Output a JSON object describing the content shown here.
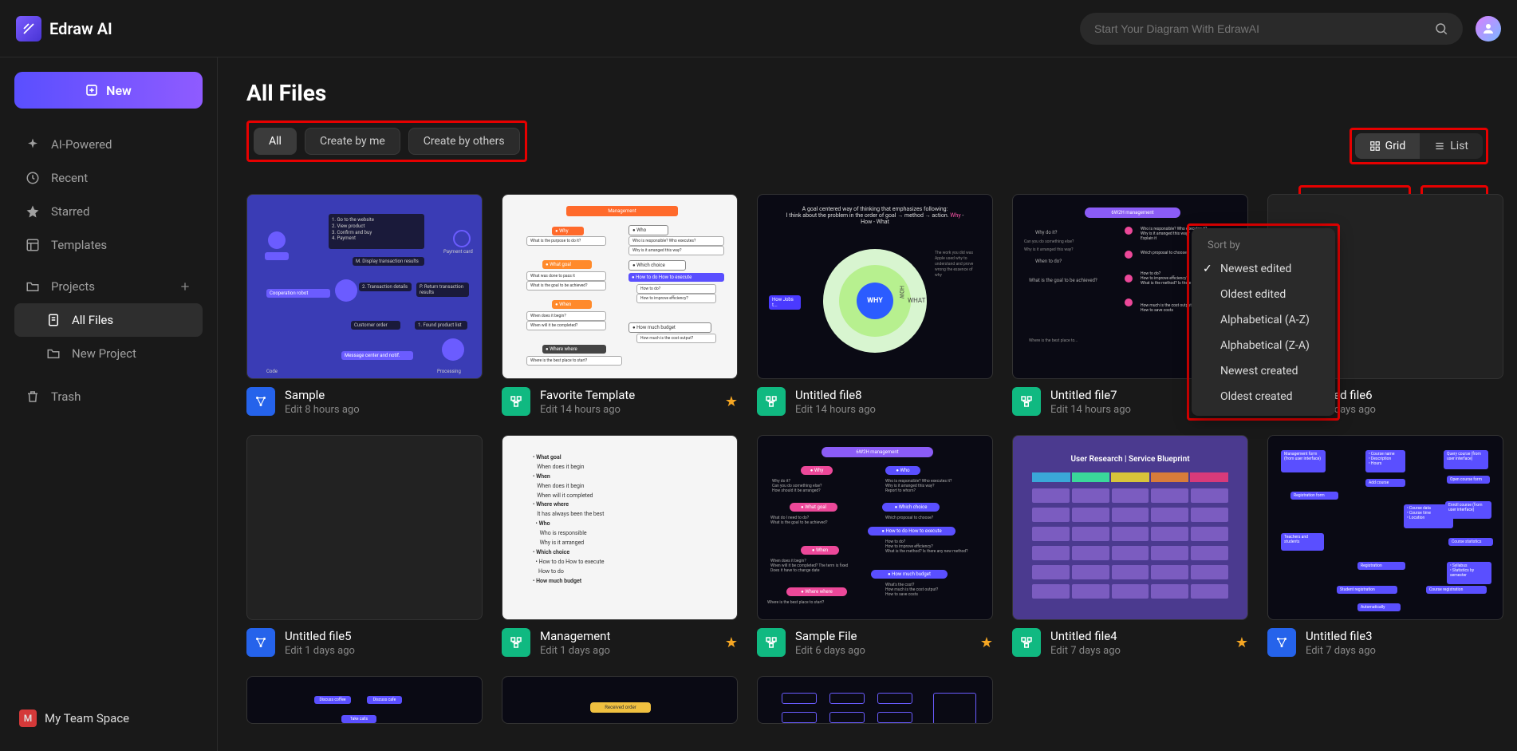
{
  "app_name": "Edraw AI",
  "search_placeholder": "Start Your Diagram With EdrawAI",
  "sidebar": {
    "new_label": "New",
    "items": [
      {
        "label": "AI-Powered",
        "icon": "sparkle-icon"
      },
      {
        "label": "Recent",
        "icon": "clock-icon"
      },
      {
        "label": "Starred",
        "icon": "star-icon"
      },
      {
        "label": "Templates",
        "icon": "template-icon"
      }
    ],
    "projects_label": "Projects",
    "project_children": [
      {
        "label": "All Files",
        "icon": "files-icon",
        "active": true
      },
      {
        "label": "New Project",
        "icon": "folder-icon"
      }
    ],
    "trash_label": "Trash",
    "team_badge": "M",
    "team_label": "My Team Space"
  },
  "page_title": "All Files",
  "tabs": [
    {
      "label": "All",
      "active": true
    },
    {
      "label": "Create by me"
    },
    {
      "label": "Create by others"
    }
  ],
  "view_toggle": {
    "grid": "Grid",
    "list": "List"
  },
  "sort_label": "Newest edited",
  "filter_label": "All files",
  "sort_menu": {
    "title": "Sort by",
    "options": [
      {
        "label": "Newest edited",
        "selected": true
      },
      {
        "label": "Oldest edited"
      },
      {
        "label": "Alphabetical (A-Z)"
      },
      {
        "label": "Alphabetical (Z-A)"
      },
      {
        "label": "Newest created"
      },
      {
        "label": "Oldest created"
      }
    ]
  },
  "files": [
    {
      "name": "Sample",
      "time": "Edit 8 hours ago",
      "icon": "blue",
      "thumb": "flow-purple"
    },
    {
      "name": "Favorite Template",
      "time": "Edit 14 hours ago",
      "icon": "green",
      "starred": true,
      "thumb": "mgmt-light"
    },
    {
      "name": "Untitled file8",
      "time": "Edit 14 hours ago",
      "icon": "green",
      "thumb": "why-dark"
    },
    {
      "name": "Untitled file7",
      "time": "Edit 14 hours ago",
      "icon": "green",
      "thumb": "6w2h-dark"
    },
    {
      "name": "Untitled file6",
      "time": "Edit 1 days ago",
      "icon": "blue",
      "thumb": "blank"
    },
    {
      "name": "Untitled file5",
      "time": "Edit 1 days ago",
      "icon": "blue",
      "thumb": "blank"
    },
    {
      "name": "Management",
      "time": "Edit 1 days ago",
      "icon": "green",
      "starred": true,
      "thumb": "outline-light"
    },
    {
      "name": "Sample File",
      "time": "Edit 6 days ago",
      "icon": "green",
      "starred": true,
      "thumb": "6w2h-dark2"
    },
    {
      "name": "Untitled file4",
      "time": "Edit 7 days ago",
      "icon": "green",
      "starred": true,
      "thumb": "blueprint"
    },
    {
      "name": "Untitled file3",
      "time": "Edit 7 days ago",
      "icon": "blue",
      "thumb": "course-dark"
    },
    {
      "name": "",
      "time": "",
      "icon": "blue",
      "thumb": "flow-dark-partial"
    },
    {
      "name": "",
      "time": "",
      "icon": "green",
      "thumb": "flow-yellow-partial"
    },
    {
      "name": "",
      "time": "",
      "icon": "green",
      "thumb": "wire-partial"
    }
  ]
}
